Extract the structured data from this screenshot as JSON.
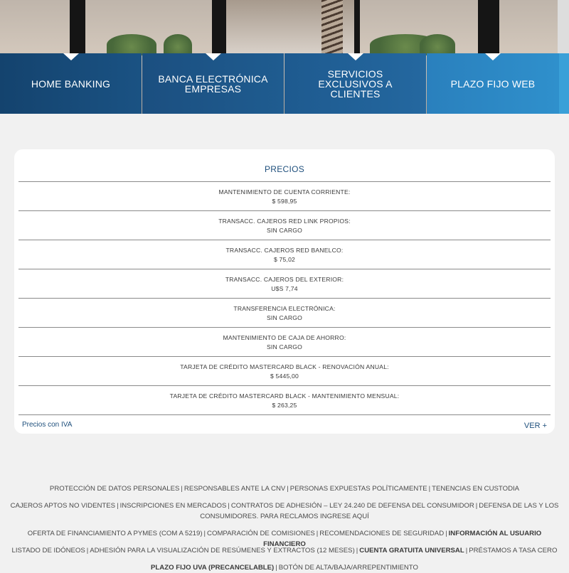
{
  "nav": {
    "items": [
      {
        "label": "HOME BANKING"
      },
      {
        "label": "BANCA ELECTRÓNICA EMPRESAS"
      },
      {
        "label": "SERVICIOS EXCLUSIVOS A CLIENTES"
      },
      {
        "label": "PLAZO FIJO WEB"
      }
    ]
  },
  "prices": {
    "title": "PRECIOS",
    "rows": [
      {
        "label": "MANTENIMIENTO DE CUENTA CORRIENTE:",
        "value": "$ 598,95"
      },
      {
        "label": "TRANSACC. CAJEROS RED LINK PROPIOS:",
        "value": "SIN CARGO"
      },
      {
        "label": "TRANSACC. CAJEROS RED BANELCO:",
        "value": "$ 75,02"
      },
      {
        "label": "TRANSACC. CAJEROS DEL EXTERIOR:",
        "value": "U$S 7,74"
      },
      {
        "label": "TRANSFERENCIA ELECTRÓNICA:",
        "value": "SIN CARGO"
      },
      {
        "label": "MANTENIMIENTO DE CAJA DE AHORRO:",
        "value": "SIN CARGO"
      },
      {
        "label": "TARJETA DE CRÉDITO MASTERCARD BLACK - RENOVACIÓN ANUAL:",
        "value": "$ 5445,00"
      },
      {
        "label": "TARJETA DE CRÉDITO MASTERCARD BLACK - MANTENIMIENTO MENSUAL:",
        "value": "$ 263,25"
      }
    ],
    "note": "Precios con IVA",
    "more": "VER +"
  },
  "footer": {
    "line1": [
      "PROTECCIÓN DE DATOS PERSONALES",
      "RESPONSABLES ANTE LA CNV",
      "PERSONAS EXPUESTAS POLÍTICAMENTE",
      "TENENCIAS EN CUSTODIA"
    ],
    "line2": [
      "CAJEROS APTOS NO VIDENTES",
      "INSCRIPCIONES EN MERCADOS",
      "CONTRATOS DE ADHESIÓN – LEY 24.240 DE DEFENSA DEL CONSUMIDOR",
      "DEFENSA DE LAS Y LOS CONSUMIDORES. PARA RECLAMOS INGRESE AQUÍ"
    ],
    "line3": [
      "OFERTA DE FINANCIAMIENTO A PYMES (COM A 5219)",
      "COMPARACIÓN DE COMISIONES",
      "RECOMENDACIONES DE SEGURIDAD",
      "INFORMACIÓN AL USUARIO FINANCIERO"
    ],
    "line4": [
      "LISTADO DE IDÓNEOS",
      "ADHESIÓN PARA LA VISUALIZACIÓN DE RESÚMENES Y EXTRACTOS (12 MESES)",
      "CUENTA GRATUITA UNIVERSAL",
      "PRÉSTAMOS A TASA CERO"
    ],
    "line5": [
      "PLAZO FIJO UVA (PRECANCELABLE)",
      "BOTÓN DE ALTA/BAJA/ARREPENTIMIENTO"
    ],
    "separator": "|"
  }
}
